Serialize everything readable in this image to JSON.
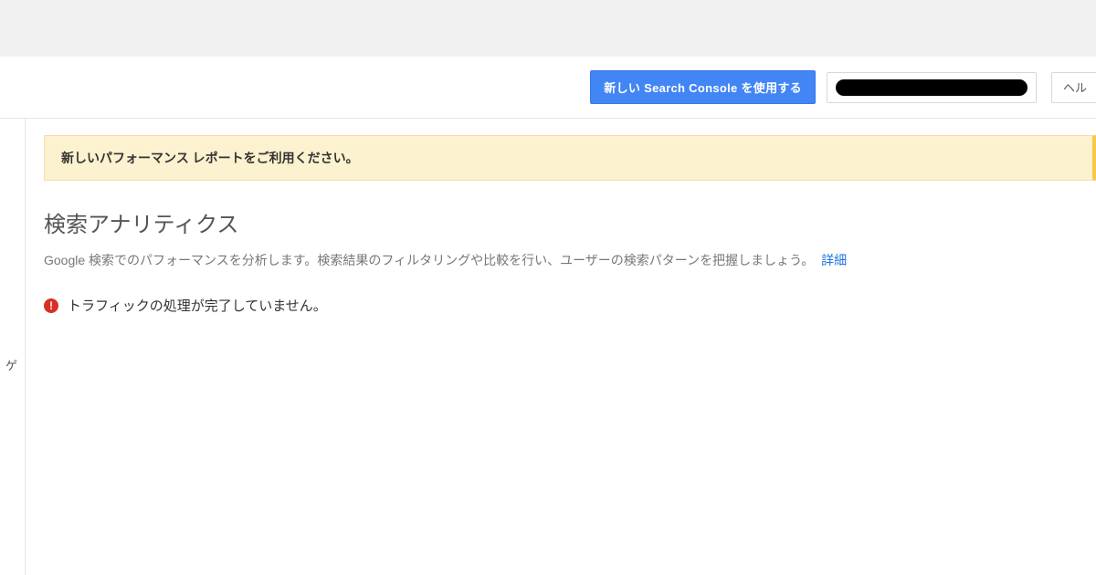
{
  "toolbar": {
    "primary_button": "新しい Search Console を使用する",
    "help_label": "ヘル"
  },
  "sidebar": {
    "fragment": "ゲ"
  },
  "notice": {
    "text": "新しいパフォーマンス レポートをご利用ください。"
  },
  "main": {
    "title": "検索アナリティクス",
    "description": "Google 検索でのパフォーマンスを分析します。検索結果のフィルタリングや比較を行い、ユーザーの検索パターンを把握しましょう。",
    "more_link": "詳細"
  },
  "status": {
    "icon_glyph": "!",
    "text": "トラフィックの処理が完了していません。"
  }
}
